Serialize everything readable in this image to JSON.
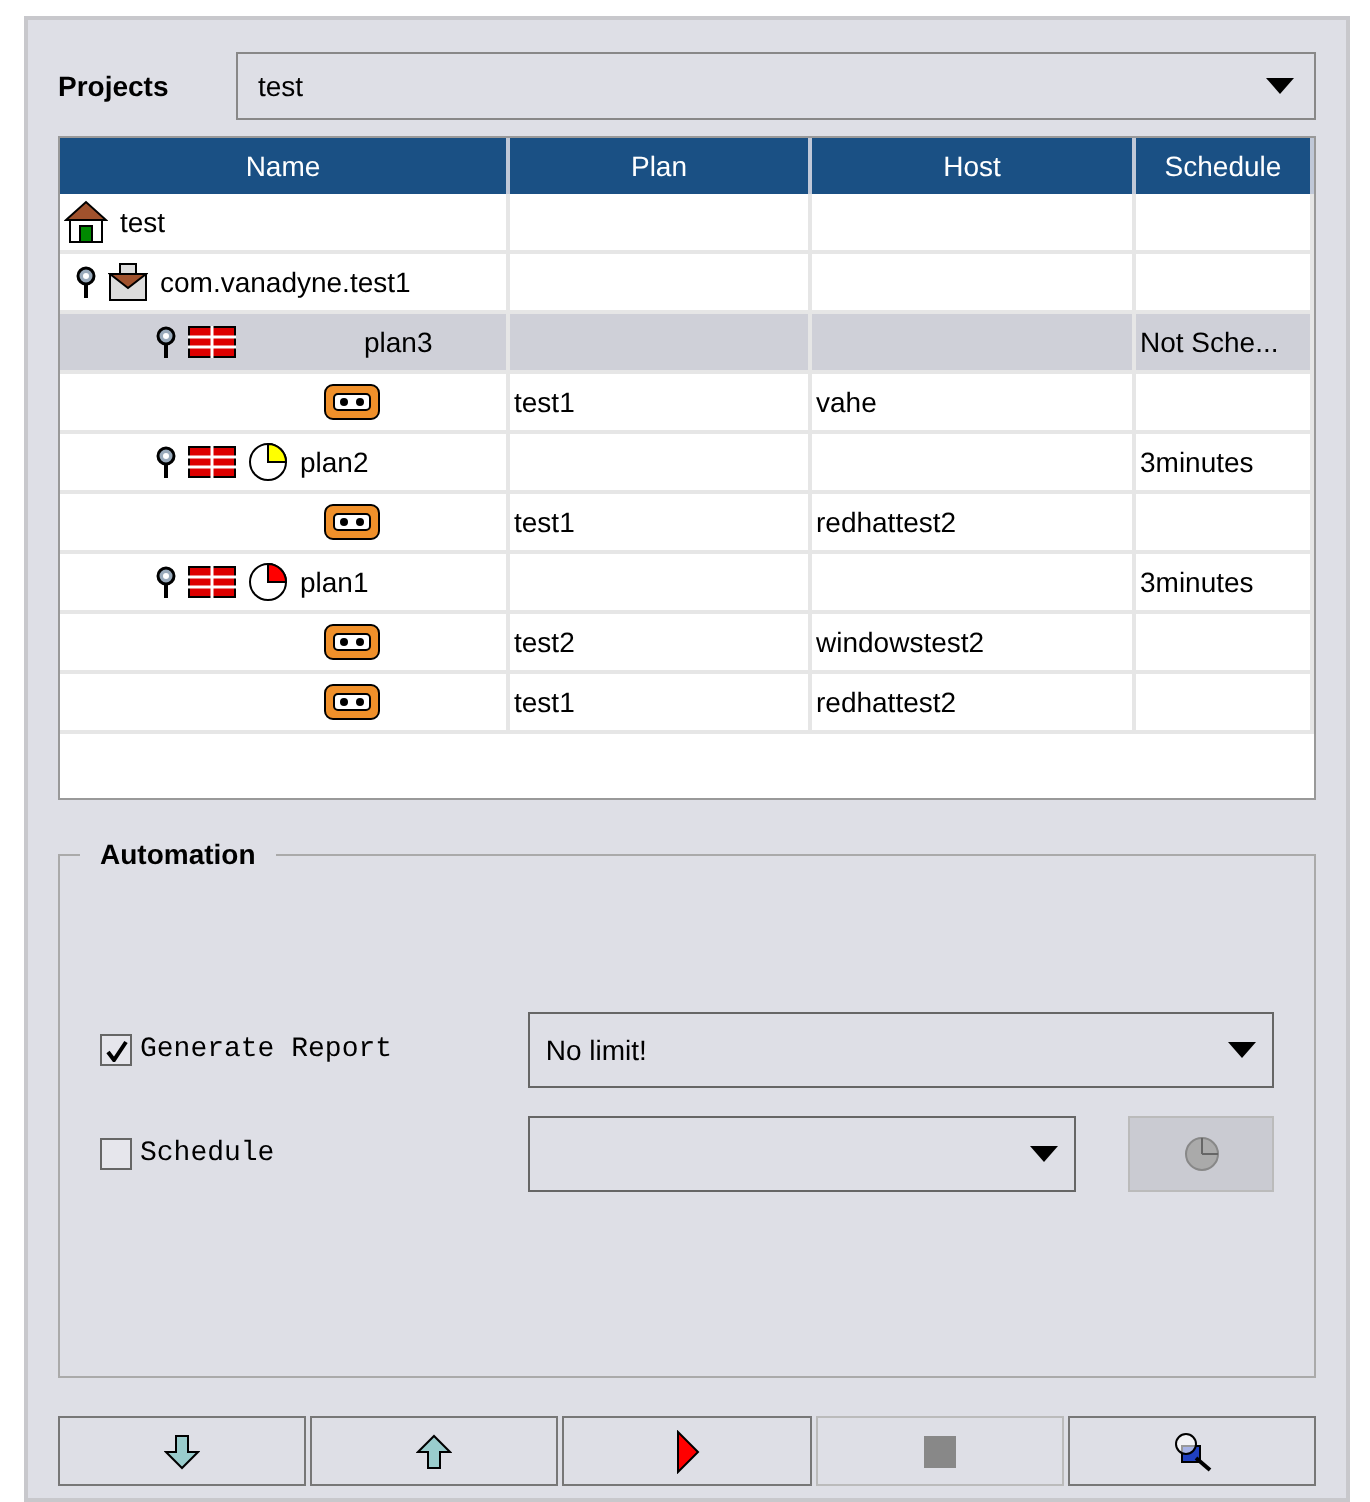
{
  "projects": {
    "label": "Projects",
    "value": "test"
  },
  "table": {
    "columns": [
      "Name",
      "Plan",
      "Host",
      "Schedule"
    ],
    "tree": [
      {
        "kind": "project",
        "name": "test",
        "selected": false,
        "children": [
          {
            "kind": "package",
            "name": "com.vanadyne.test1",
            "selected": false,
            "children": [
              {
                "kind": "plan",
                "name": "plan3",
                "selected": true,
                "schedule": "Not Sche...",
                "children": [
                  {
                    "kind": "host",
                    "selected": false,
                    "plan": "test1",
                    "host": "vahe"
                  }
                ]
              },
              {
                "kind": "plan",
                "name": "plan2",
                "selected": false,
                "color": "#ffff00",
                "schedule": "3minutes",
                "children": [
                  {
                    "kind": "host",
                    "selected": false,
                    "plan": "test1",
                    "host": "redhattest2"
                  }
                ]
              },
              {
                "kind": "plan",
                "name": "plan1",
                "selected": false,
                "color": "#ff0000",
                "schedule": "3minutes",
                "children": [
                  {
                    "kind": "host",
                    "selected": false,
                    "plan": "test2",
                    "host": "windowstest2"
                  },
                  {
                    "kind": "host",
                    "selected": false,
                    "plan": "test1",
                    "host": "redhattest2"
                  }
                ]
              }
            ]
          }
        ]
      }
    ]
  },
  "automation": {
    "title": "Automation",
    "generate_report": {
      "label": "Generate Report",
      "checked": true,
      "value": "No limit!"
    },
    "schedule": {
      "label": "Schedule",
      "checked": false,
      "button_disabled": true
    }
  },
  "toolbar": [
    {
      "kind": "down",
      "disabled": false
    },
    {
      "kind": "up",
      "disabled": false
    },
    {
      "kind": "run",
      "disabled": false
    },
    {
      "kind": "stop",
      "disabled": true
    },
    {
      "kind": "inspect",
      "disabled": false
    }
  ]
}
